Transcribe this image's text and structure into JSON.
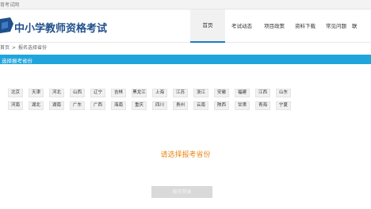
{
  "topbar": {
    "text": "育考试网"
  },
  "header": {
    "title": "中小学教师资格考试",
    "nav": [
      "首页",
      "考试动态",
      "项目政策",
      "资料下载",
      "常见问题",
      "联"
    ]
  },
  "breadcrumb": {
    "home": "首页",
    "separator": ">",
    "current": "报名选择省份"
  },
  "banner": {
    "text": "选择报考省份"
  },
  "provinces": [
    [
      "北京",
      "天津",
      "河北",
      "山西",
      "辽宁",
      "吉林",
      "黑龙江",
      "上海",
      "江苏",
      "浙江",
      "安徽",
      "福建",
      "江西",
      "山东"
    ],
    [
      "河南",
      "湖北",
      "湖南",
      "广东",
      "广西",
      "海南",
      "重庆",
      "四川",
      "贵州",
      "云南",
      "陕西",
      "甘肃",
      "青海",
      "宁夏"
    ]
  ],
  "prompt": "请选择报考省份",
  "submit_label": "报名登录",
  "colors": {
    "brand_blue": "#1f4f8c",
    "banner": "#1fa5dc",
    "prompt": "#e98a1b",
    "active_underline": "#1a7fc1"
  }
}
